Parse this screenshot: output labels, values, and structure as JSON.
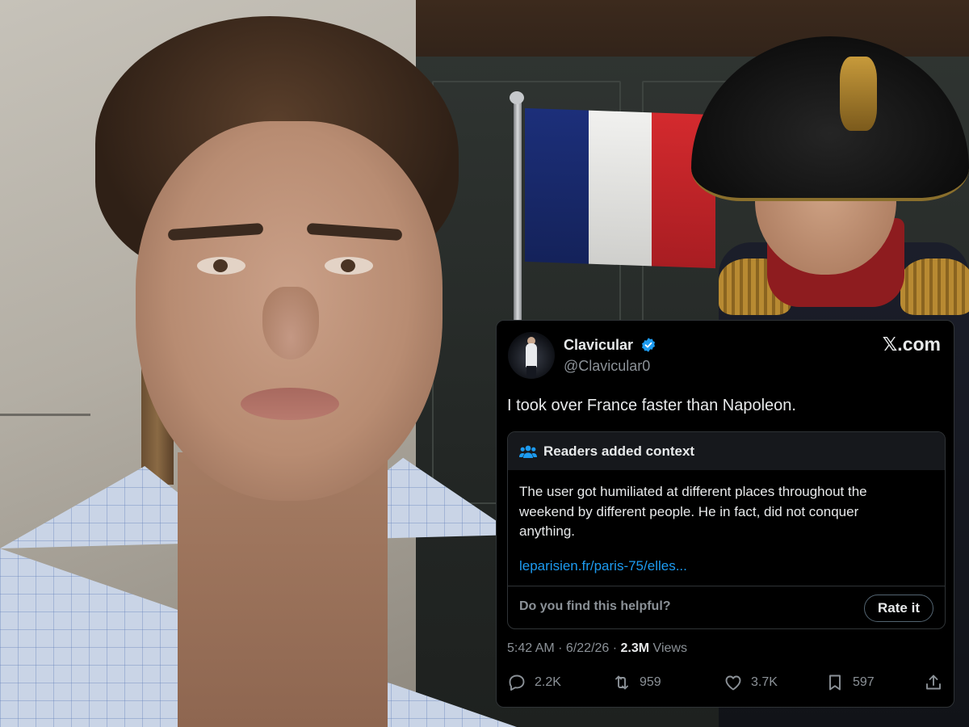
{
  "post": {
    "display_name": "Clavicular",
    "handle": "@Clavicular0",
    "site_label": "𝕏.com",
    "text": "I took over France faster than Napoleon.",
    "verified_icon": "verified-badge-icon",
    "community_note": {
      "header": "Readers added context",
      "body": "The user got humiliated at different places throughout the weekend by different people. He in fact, did not conquer anything.",
      "link": "leparisien.fr/paris-75/elles...",
      "helpful_prompt": "Do you find this helpful?",
      "rate_label": "Rate it"
    },
    "time": "5:42 AM · 6/22/26 · ",
    "views_count": "2.3M",
    "views_label": " Views",
    "stats": {
      "replies": "2.2K",
      "reposts": "959",
      "likes": "3.7K",
      "bookmarks": "597"
    }
  },
  "colors": {
    "card_bg": "#000000",
    "accent_blue": "#1d9bf0",
    "muted_text": "#8b9197",
    "flag_blue": "#1c2f7a",
    "flag_white": "#f1f1ef",
    "flag_red": "#d42a2e"
  }
}
